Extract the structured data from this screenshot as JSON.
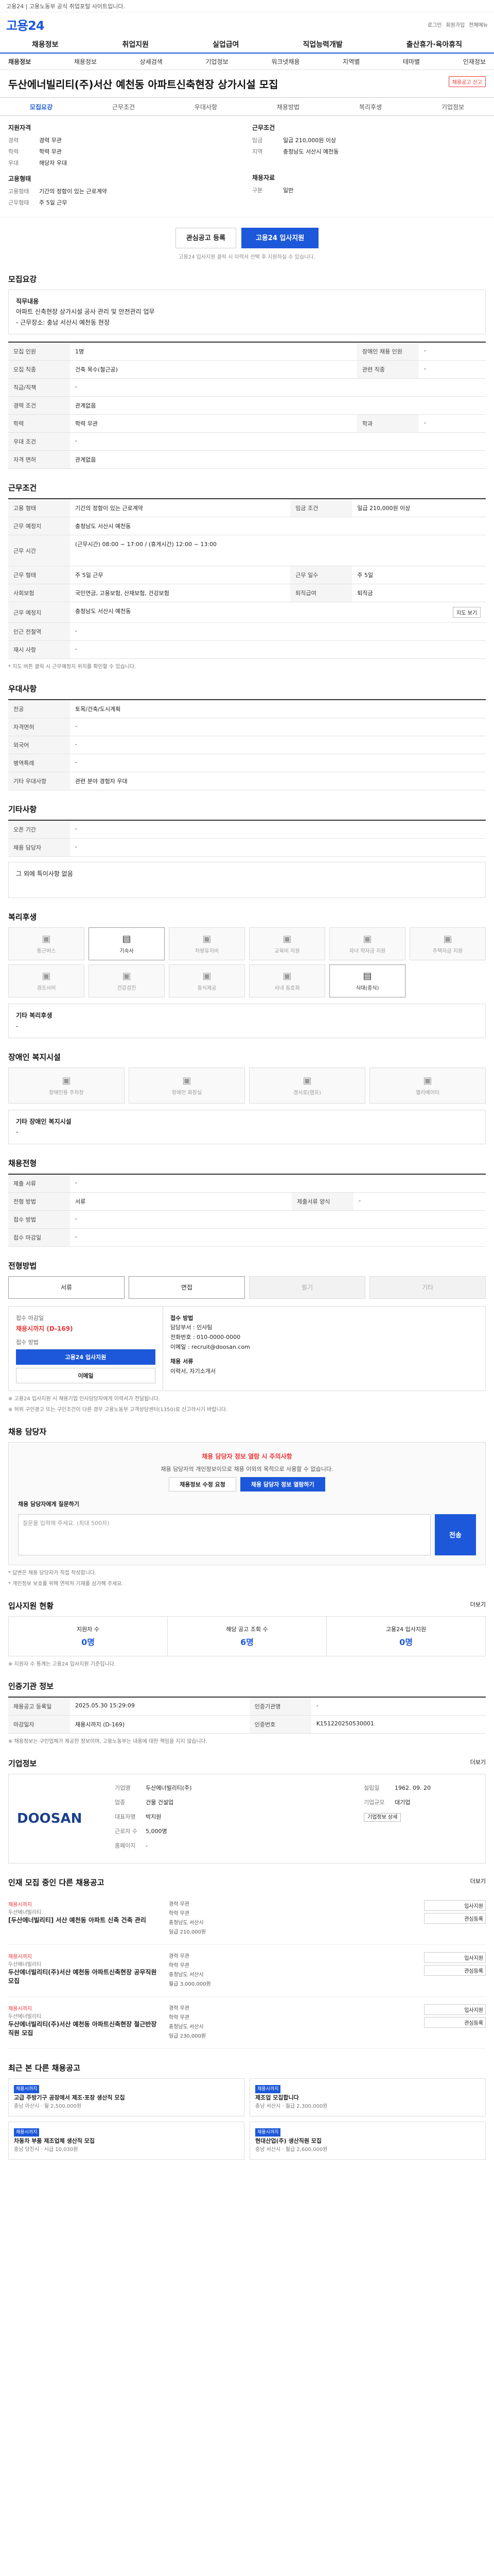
{
  "topbar": {
    "text": "고용24 | 고용노동부 공식 취업포털 사이트입니다."
  },
  "logo": {
    "text": "고용24",
    "links": [
      "로그인",
      "회원가입",
      "전체메뉴"
    ]
  },
  "gnb": [
    "채용정보",
    "취업지원",
    "실업급여",
    "직업능력개발",
    "출산휴가·육아휴직"
  ],
  "subnav": {
    "left": "채용정보",
    "items": [
      "채용정보",
      "상세검색",
      "기업정보",
      "워크넷채용",
      "지역별",
      "테마별",
      "인재정보"
    ]
  },
  "title": "두산에너빌리티(주)서산 예천동 아파트신축현장 상가시설 모집",
  "title_buttons": {
    "scrap": "관심등록",
    "report": "채용공고 신고"
  },
  "tabs": [
    "모집요강",
    "근무조건",
    "우대사항",
    "채용방법",
    "복리후생",
    "기업정보"
  ],
  "summary": {
    "left_title": "지원자격",
    "left": [
      [
        "경력",
        "경력 무관"
      ],
      [
        "학력",
        "학력 무관"
      ],
      [
        "우대",
        "해당자 우대"
      ]
    ],
    "right_title": "근무조건",
    "right": [
      [
        "임금",
        "일급 210,000원 이상"
      ],
      [
        "지역",
        "충청남도 서산시 예천동"
      ]
    ],
    "left2_title": "고용형태",
    "left2": [
      [
        "고용형태",
        "기간의 정함이 있는 근로계약"
      ],
      [
        "근무형태",
        "주 5일 근무"
      ]
    ],
    "right2_title": "채용자료",
    "right2": [
      [
        "구분",
        "일반"
      ]
    ]
  },
  "apply": {
    "scrap": "관심공고 등록",
    "apply": "고용24 입사지원",
    "note": "고용24 입사지원 클릭 시 이력서 선택 후 지원하실 수 있습니다."
  },
  "recruit": {
    "heading": "모집요강",
    "box_title": "직무내용",
    "box_lines": [
      "아파트 신축현장 상가시설 공사 관리 및 안전관리 업무",
      "- 근무장소: 충남 서산시 예천동 현장"
    ],
    "rows": [
      [
        "모집 인원",
        "1명",
        "장애인 채용 인원",
        "-"
      ],
      [
        "모집 직종",
        "건축 목수(철근공)",
        "관련 직종",
        "-"
      ],
      [
        "직급/직책",
        "-",
        "",
        ""
      ],
      [
        "경력 조건",
        "관계없음",
        "",
        ""
      ],
      [
        "학력",
        "학력 무관",
        "학과",
        "-"
      ],
      [
        "우대 조건",
        "-",
        "",
        ""
      ],
      [
        "자격 면허",
        "관계없음",
        "",
        ""
      ]
    ]
  },
  "work": {
    "heading": "근무조건",
    "rows": [
      [
        "고용 형태",
        "기간의 정함이 있는 근로계약",
        "임금 조건",
        "일급 210,000원 이상"
      ],
      [
        "근무 예정지",
        "충청남도 서산시 예천동",
        "",
        ""
      ],
      [
        "근무 시간",
        "(근무시간) 08:00 ~ 17:00 / (휴게시간) 12:00 ~ 13:00",
        "",
        ""
      ],
      [
        "근무 형태",
        "주 5일 근무",
        "근무 일수",
        "주 5일"
      ],
      [
        "사회보험",
        "국민연금, 고용보험, 산재보험, 건강보험",
        "퇴직급여",
        "퇴직금"
      ],
      [
        "근무 예정지",
        "충청남도 서산시 예천동",
        "",
        ""
      ],
      [
        "인근 전철역",
        "-",
        "",
        ""
      ],
      [
        "재시 사항",
        "-",
        "",
        ""
      ]
    ],
    "note": "* 지도 버튼 클릭 시 근무예정지 위치를 확인할 수 있습니다.",
    "map_button": "지도 보기"
  },
  "prefer": {
    "heading": "우대사항",
    "rows": [
      [
        "전공",
        "토목/건축/도시계획"
      ],
      [
        "자격면허",
        "-"
      ],
      [
        "외국어",
        "-"
      ],
      [
        "병역특례",
        "-"
      ],
      [
        "기타 우대사항",
        "관련 분야 경험자 우대"
      ]
    ]
  },
  "etc": {
    "heading": "기타사항",
    "rows": [
      [
        "오픈 기간",
        "-"
      ],
      [
        "채용 담당자",
        "-"
      ]
    ],
    "box": "그 외에 특이사항 없음"
  },
  "welfare": {
    "heading": "복리후생",
    "items": [
      {
        "name": "통근버스",
        "icon": "bus-icon",
        "on": false
      },
      {
        "name": "기숙사",
        "icon": "bed-icon",
        "on": true
      },
      {
        "name": "차량유지비",
        "icon": "car-icon",
        "on": false
      },
      {
        "name": "교육비 지원",
        "icon": "book-icon",
        "on": false
      },
      {
        "name": "자녀 학자금 지원",
        "icon": "child-icon",
        "on": false
      },
      {
        "name": "주택자금 지원",
        "icon": "house-icon",
        "on": false
      },
      {
        "name": "경조사비",
        "icon": "gift-icon",
        "on": false
      },
      {
        "name": "건강검진",
        "icon": "health-icon",
        "on": false
      },
      {
        "name": "중식제공",
        "icon": "meal-icon",
        "on": false
      },
      {
        "name": "사내 동호회",
        "icon": "club-icon",
        "on": false
      },
      {
        "name": "식대(중식)",
        "icon": "food-icon",
        "on": true
      }
    ],
    "note": "기타 복리후생",
    "note_value": "-"
  },
  "disability": {
    "heading": "장애인 복지시설",
    "items": [
      "장애인용 주차장",
      "장애인 화장실",
      "경사로(램프)",
      "엘리베이터"
    ],
    "note": "기타 장애인 복지시설",
    "note_value": "-"
  },
  "recruit_method": {
    "heading": "채용전형",
    "rows": [
      [
        "제출 서류",
        "-",
        "",
        ""
      ],
      [
        "전형 방법",
        "서류",
        "제출서류 양식",
        "-"
      ],
      [
        "접수 방법",
        "-",
        "",
        ""
      ],
      [
        "접수 마감일",
        "-",
        "",
        ""
      ]
    ]
  },
  "method": {
    "heading": "전형방법",
    "items": [
      {
        "label": "서류",
        "on": true
      },
      {
        "label": "면접",
        "on": true
      },
      {
        "label": "필기",
        "on": false
      },
      {
        "label": "기타",
        "on": false
      }
    ]
  },
  "contact": {
    "left_title": "접수 마감일",
    "left_value": "채용시까지 (D-169)",
    "left_label": "접수 방법",
    "left_button": "고용24 입사지원",
    "left_button2": "이메일",
    "right_title": "접수 방법",
    "right_lines": [
      "담당부서 : 인사팀",
      "전화번호 : 010-0000-0000",
      "이메일 : recruit@doosan.com"
    ],
    "right_title2": "채용 서류",
    "right_lines2": [
      "이력서, 자기소개서"
    ]
  },
  "notice": [
    "※ 고용24 입사지원 시 채용기업 인사담당자에게 이력서가 전달됩니다.",
    "※ 허위 구인광고 또는 구인조건이 다른 경우 고용노동부 고객상담센터(1350)로 신고하시기 바랍니다."
  ],
  "qa": {
    "heading": "채용 담당자",
    "alert": "채용 담당자 정보 열람 시 주의사항",
    "body": "채용 담당자의 개인정보이므로 채용 이외의 목적으로 사용할 수 없습니다.",
    "btn1": "채용정보 수정 요청",
    "btn2": "채용 담당자 정보 열람하기",
    "input_label": "채용 담당자에게 질문하기",
    "placeholder": "질문을 입력해 주세요. (최대 500자)",
    "send": "전송",
    "notes": [
      "* 답변은 채용 담당자가 직접 작성합니다.",
      "* 개인정보 보호를 위해 연락처 기재를 삼가해 주세요."
    ]
  },
  "stats": {
    "heading": "입사지원 현황",
    "more": "더보기",
    "items": [
      {
        "label": "지원자 수",
        "value": "0명"
      },
      {
        "label": "해당 공고 조회 수",
        "value": "6명"
      },
      {
        "label": "고용24 입사지원",
        "value": "0명"
      }
    ],
    "note": "※ 지원자 수 통계는 고용24 입사지원 기준입니다."
  },
  "info": {
    "heading": "인증기관 정보",
    "rows": [
      [
        "채용공고 등록일",
        "2025.05.30 15:29:09",
        "인증기관명",
        "-"
      ],
      [
        "마감일자",
        "채용시까지 (D-169)",
        "인증번호",
        "K151220250530001"
      ]
    ],
    "notes": [
      "※ 채용정보는 구인업체가 제공한 정보이며, 고용노동부는 내용에 대한 책임을 지지 않습니다."
    ]
  },
  "company": {
    "heading": "기업정보",
    "more": "더보기",
    "logo": "DOOSAN",
    "rows": [
      [
        "기업명",
        "두산에너빌리티(주)"
      ],
      [
        "업종",
        "건물 건설업"
      ],
      [
        "대표자명",
        "박지원"
      ],
      [
        "근로자 수",
        "5,000명"
      ],
      [
        "홈페이지",
        "-"
      ]
    ],
    "side": [
      [
        "설립일",
        "1962. 09. 20"
      ],
      [
        "기업규모",
        "대기업"
      ]
    ],
    "btn": "기업정보 상세"
  },
  "related": {
    "heading": "인재 모집 중인 다른 채용공고",
    "more": "더보기",
    "items": [
      {
        "tag": "채용시까지",
        "company": "두산에너빌리티",
        "title": "[두산에너빌리티] 서산 예천동 아파트 신축 건축 관리",
        "meta": [
          "경력 무관",
          "학력 무관",
          "충청남도 서산시",
          "일급 210,000원"
        ],
        "btn1": "입사지원",
        "btn2": "관심등록"
      },
      {
        "tag": "채용시까지",
        "company": "두산에너빌리티",
        "title": "두산에너빌리티(주)서산 예천동 아파트신축현장 공무직원 모집",
        "meta": [
          "경력 무관",
          "학력 무관",
          "충청남도 서산시",
          "월급 3,000,000원"
        ],
        "btn1": "입사지원",
        "btn2": "관심등록"
      },
      {
        "tag": "채용시까지",
        "company": "두산에너빌리티",
        "title": "두산에너빌리티(주)서산 예천동 아파트신축현장 철근반장 직원 모집",
        "meta": [
          "경력 무관",
          "학력 무관",
          "충청남도 서산시",
          "일급 230,000원"
        ],
        "btn1": "입사지원",
        "btn2": "관심등록"
      }
    ]
  },
  "recent": {
    "heading": "최근 본 다른 채용공고",
    "items": [
      {
        "tag": "채용시까지",
        "title": "고급 주방기구 공장에서 제조·포장 생산직 모집",
        "meta": "충남 아산시 · 월 2,500,000원"
      },
      {
        "tag": "채용시까지",
        "title": "제조업 모집합니다",
        "meta": "충남 서산시 · 월급 2,300,000원"
      },
      {
        "tag": "채용시까지",
        "title": "차동차 부품 제조업체 생산직 모집",
        "meta": "충남 당진시 · 시급 10,030원"
      },
      {
        "tag": "채용시까지",
        "title": "현대산업(주) 생산직원 모집",
        "meta": "충남 서산시 · 월급 2,600,000원"
      }
    ]
  }
}
